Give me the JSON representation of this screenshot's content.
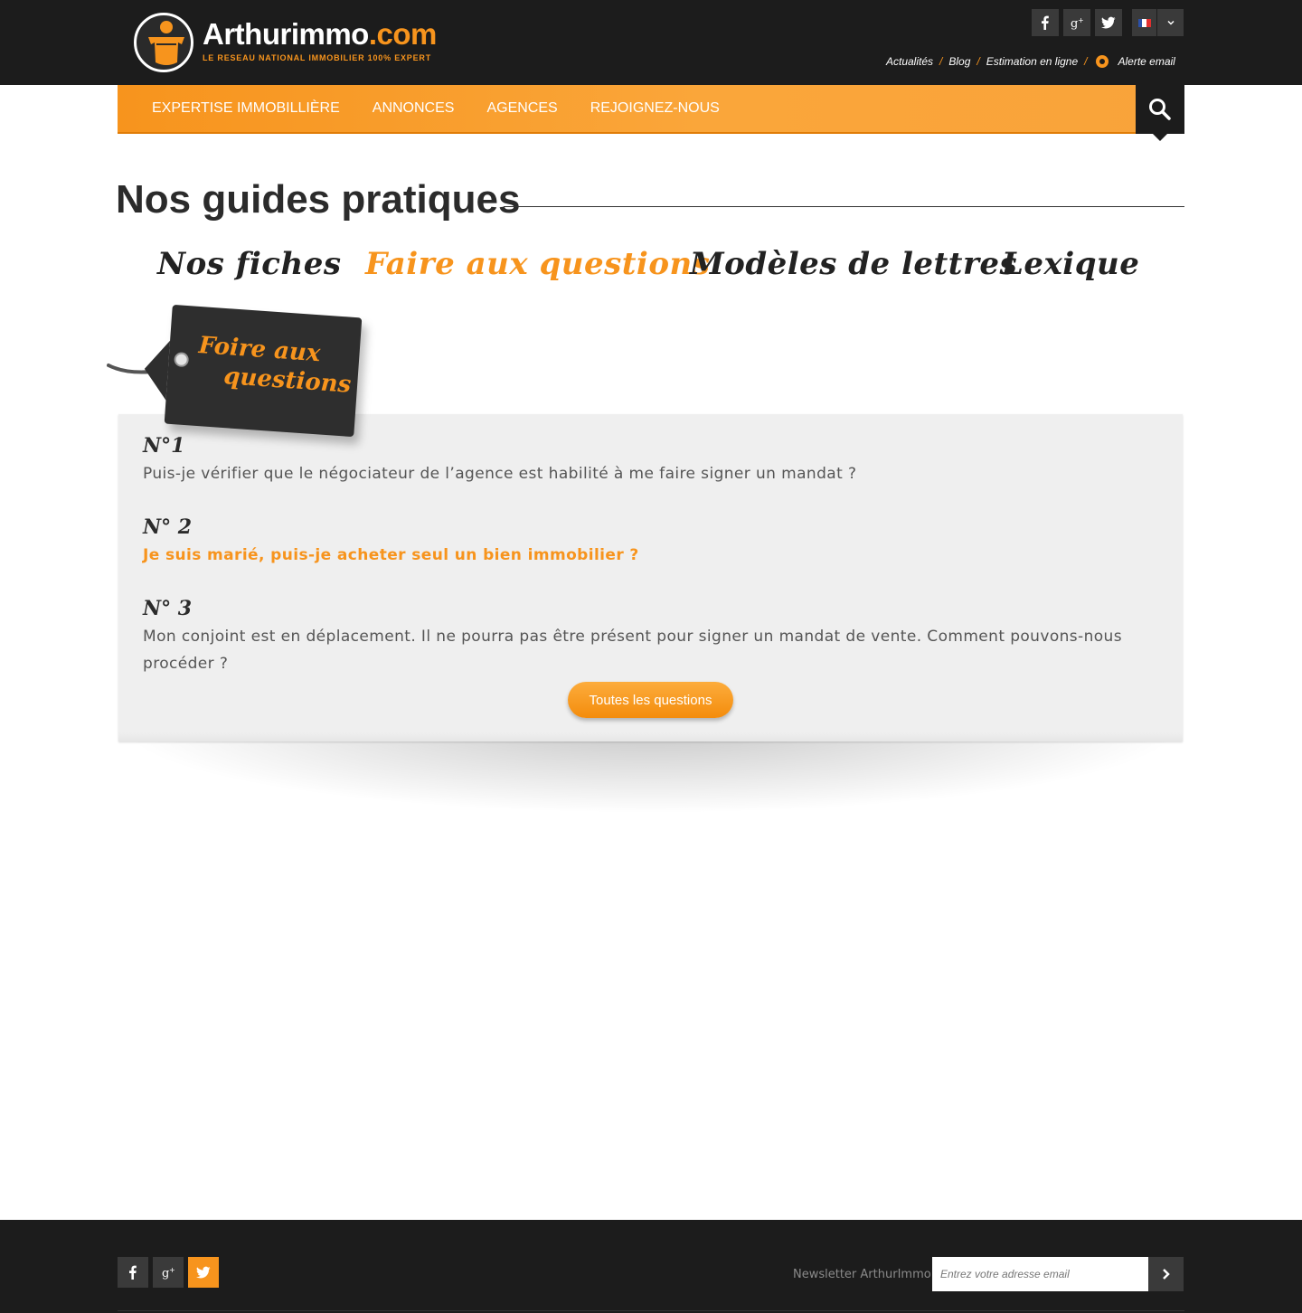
{
  "brand": {
    "name": "Arthurimmo",
    "domain_suffix": ".com",
    "tagline": "LE RESEAU NATIONAL IMMOBILIER 100% EXPERT",
    "accent_color": "#f7941d",
    "dark_color": "#1c1c1c"
  },
  "header": {
    "social": [
      {
        "icon": "facebook-icon",
        "glyph": "f"
      },
      {
        "icon": "google-plus-icon",
        "glyph": "g+"
      },
      {
        "icon": "twitter-icon",
        "glyph": "t"
      }
    ],
    "language": {
      "selected": "fr",
      "icon": "france-flag-icon"
    },
    "links": [
      "Actualités",
      "Blog",
      "Estimation en ligne",
      "Alerte email"
    ]
  },
  "nav": {
    "items": [
      "EXPERTISE IMMOBILLIÈRE",
      "ANNONCES",
      "AGENCES",
      "REJOIGNEZ-NOUS"
    ],
    "search_icon": "search-icon"
  },
  "page": {
    "title": "Nos guides pratiques",
    "tabs": [
      {
        "label": "Nos fiches",
        "active": false
      },
      {
        "label": "Faire aux questions",
        "active": true
      },
      {
        "label": "Modèles de lettres",
        "active": false
      },
      {
        "label": "Lexique",
        "active": false
      }
    ]
  },
  "faq": {
    "tag_line1": "Foire aux",
    "tag_line2": "questions",
    "questions": [
      {
        "number": "N°1",
        "text": "Puis-je vérifier que le négociateur de l’agence est habilité à me faire signer un mandat ?",
        "highlighted": false
      },
      {
        "number": "N° 2",
        "text": "Je suis marié, puis-je acheter seul un bien immobilier ?",
        "highlighted": true
      },
      {
        "number": "N° 3",
        "text": "Mon conjoint est en déplacement. Il ne pourra pas être présent pour signer un mandat de vente. Comment pouvons-nous procéder ?",
        "highlighted": false
      }
    ],
    "all_button": "Toutes les questions"
  },
  "footer": {
    "social": [
      {
        "icon": "facebook-icon"
      },
      {
        "icon": "google-plus-icon"
      },
      {
        "icon": "twitter-icon"
      }
    ],
    "newsletter_label": "Newsletter ArthurImmo",
    "newsletter_placeholder": "Entrez votre adresse email",
    "submit_icon": "chevron-right-icon"
  }
}
